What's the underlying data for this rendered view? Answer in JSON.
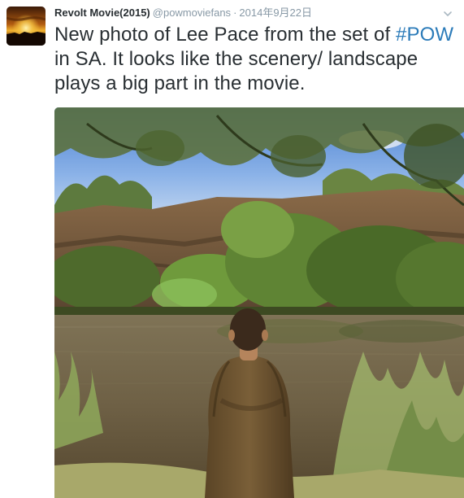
{
  "tweet": {
    "display_name": "Revolt Movie(2015)",
    "screen_name": "@powmoviefans",
    "separator": "·",
    "timestamp": "2014年9月22日",
    "text_part1": "New photo of Lee Pace from the set of ",
    "hashtag": "#POW",
    "text_part2": " in SA. It looks like the scenery/ landscape plays a big part in the movie."
  },
  "icons": {
    "avatar": "sunset-avatar",
    "caret": "chevron-down-icon"
  },
  "colors": {
    "name": "#292f33",
    "meta": "#8899a6",
    "hashtag": "#2b7bb9",
    "text": "#292f33"
  }
}
